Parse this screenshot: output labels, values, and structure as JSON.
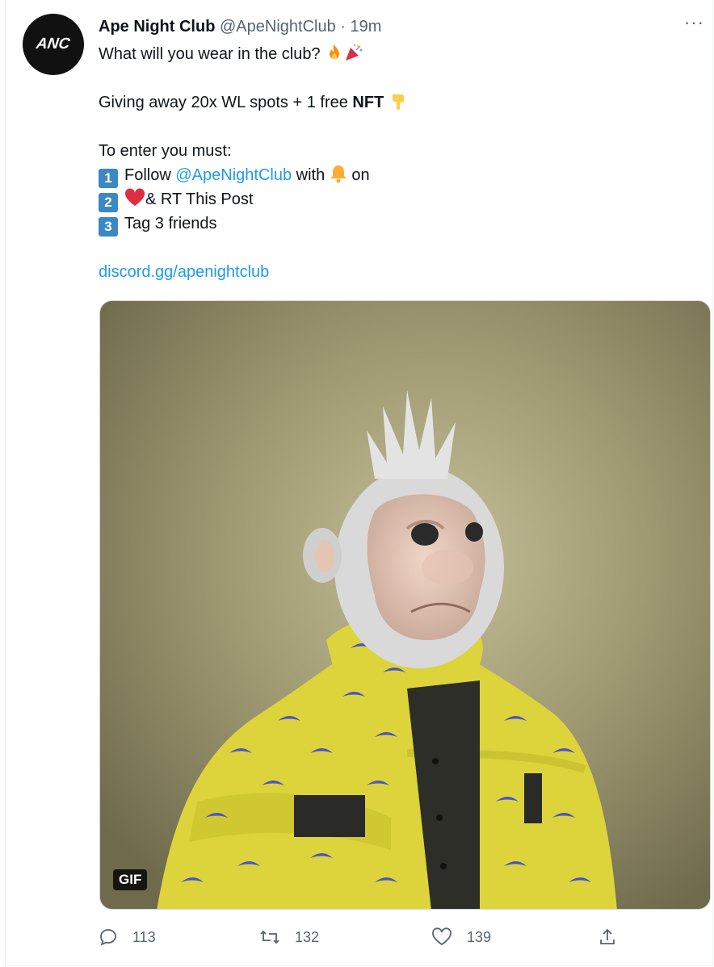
{
  "tweet": {
    "avatar_text": "ANC",
    "display_name": "Ape Night Club",
    "handle": "@ApeNightClub",
    "separator": "·",
    "time": "19m",
    "more_label": "···",
    "line1": "What will you wear in the club?",
    "giving_text": "Giving away 20x WL spots + 1 free ",
    "giving_bold": "NFT",
    "enter_text": "To enter you must:",
    "steps": [
      {
        "num": "1",
        "pre": "Follow ",
        "mention": "@ApeNightClub",
        "post": " with ",
        "post2": " on"
      },
      {
        "num": "2",
        "text": "& RT This Post"
      },
      {
        "num": "3",
        "text": "Tag 3 friends"
      }
    ],
    "discord_link": "discord.gg/apenightclub",
    "gif_badge": "GIF"
  },
  "actions": {
    "replies": "113",
    "retweets": "132",
    "likes": "139"
  },
  "colors": {
    "link": "#1d9bf0",
    "muted": "#536471",
    "number_badge": "#3b88c3"
  }
}
